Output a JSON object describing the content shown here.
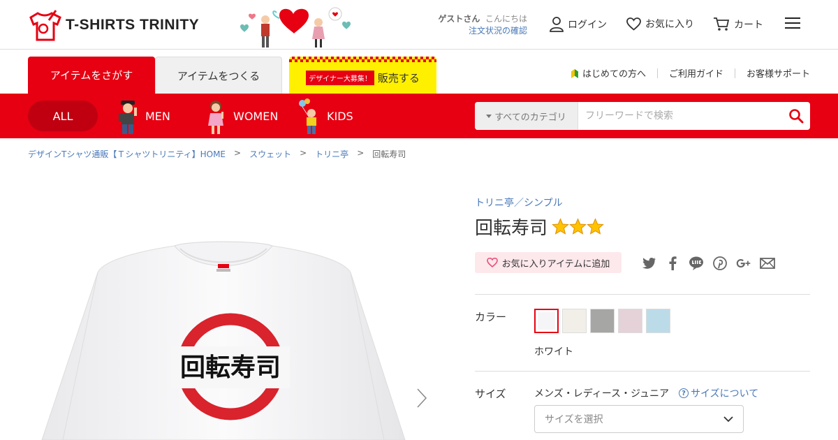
{
  "header": {
    "logo_text_prefix": "T-SHIRTS ",
    "logo_text_suffix": "TRINITY",
    "greeting_user": "ゲストさん",
    "greeting_text": "こんにちは",
    "order_status_link": "注文状況の確認",
    "login_label": "ログイン",
    "favorites_label": "お気に入り",
    "cart_label": "カート"
  },
  "tabs": {
    "search_label": "アイテムをさがす",
    "create_label": "アイテムをつくる",
    "designer_badge": "デザイナー大募集！",
    "sell_label": "販売する"
  },
  "utility_links": {
    "beginners": "はじめての方へ",
    "guide": "ご利用ガイド",
    "support": "お客様サポート"
  },
  "categories": {
    "all": "ALL",
    "men": "MEN",
    "women": "WOMEN",
    "kids": "KIDS"
  },
  "search": {
    "category_label": "すべてのカテゴリ",
    "placeholder": "フリーワードで検索"
  },
  "breadcrumb": {
    "home": "デザインTシャツ通販【Ｔシャツトリニティ】HOME",
    "level1": "スウェット",
    "level2": "トリニ亭",
    "current": "回転寿司",
    "separator": ">"
  },
  "product": {
    "print_text": "回転寿司",
    "shop_link": "トリニ亭／シンプル",
    "title": "回転寿司",
    "rating_stars": 3,
    "favorite_button": "お気に入りアイテムに追加",
    "color_label": "カラー",
    "selected_color": "ホワイト",
    "swatch_colors": [
      "#f5f5f8",
      "#f1efe8",
      "#a6a6a4",
      "#e5d2d9",
      "#bcdbe8"
    ],
    "size_label": "サイズ",
    "size_category": "メンズ・レディース・ジュニア",
    "size_help_link": "サイズについて",
    "size_select_placeholder": "サイズを選択"
  },
  "colors": {
    "brand_red": "#e60012",
    "link_blue": "#4a79b8",
    "sell_yellow": "#fff000"
  }
}
